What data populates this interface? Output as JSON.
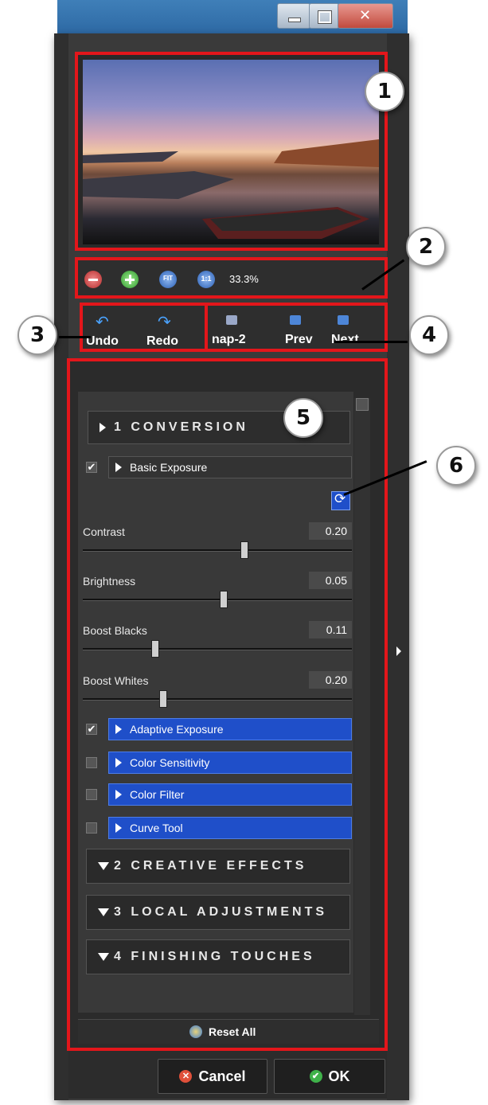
{
  "window": {
    "minimize_label": "",
    "maximize_label": "",
    "close_label": ""
  },
  "zoom": {
    "level": "33.3%",
    "fit_label": "FIT",
    "one_to_one_label": "1:1"
  },
  "history": {
    "undo_label": "Undo",
    "redo_label": "Redo"
  },
  "snapshots": {
    "snap_label": "nap-2",
    "prev_label": "Prev",
    "next_label": "Next"
  },
  "sections": {
    "conversion": {
      "label": "1 CONVERSION"
    },
    "basic_exposure": {
      "label": "Basic Exposure",
      "checked": true,
      "sliders": [
        {
          "label": "Contrast",
          "value": "0.20",
          "fraction": 0.6
        },
        {
          "label": "Brightness",
          "value": "0.05",
          "fraction": 0.525
        },
        {
          "label": "Boost Blacks",
          "value": "0.11",
          "fraction": 0.27
        },
        {
          "label": "Boost Whites",
          "value": "0.20",
          "fraction": 0.3
        }
      ]
    },
    "subsections": [
      {
        "label": "Adaptive Exposure",
        "checked": true
      },
      {
        "label": "Color Sensitivity",
        "checked": false
      },
      {
        "label": "Color Filter",
        "checked": false
      },
      {
        "label": "Curve Tool",
        "checked": false
      }
    ],
    "creative": {
      "label": "2 CREATIVE EFFECTS"
    },
    "local": {
      "label": "3 LOCAL ADJUSTMENTS"
    },
    "finishing": {
      "label": "4 FINISHING TOUCHES"
    }
  },
  "footer": {
    "reset_label": "Reset All",
    "cancel_label": "Cancel",
    "ok_label": "OK"
  },
  "callouts": [
    "1",
    "2",
    "3",
    "4",
    "5",
    "6"
  ],
  "colors": {
    "highlight": "#e3161b",
    "accent_blue": "#1f4fc9",
    "panel": "#3a3a3a"
  }
}
